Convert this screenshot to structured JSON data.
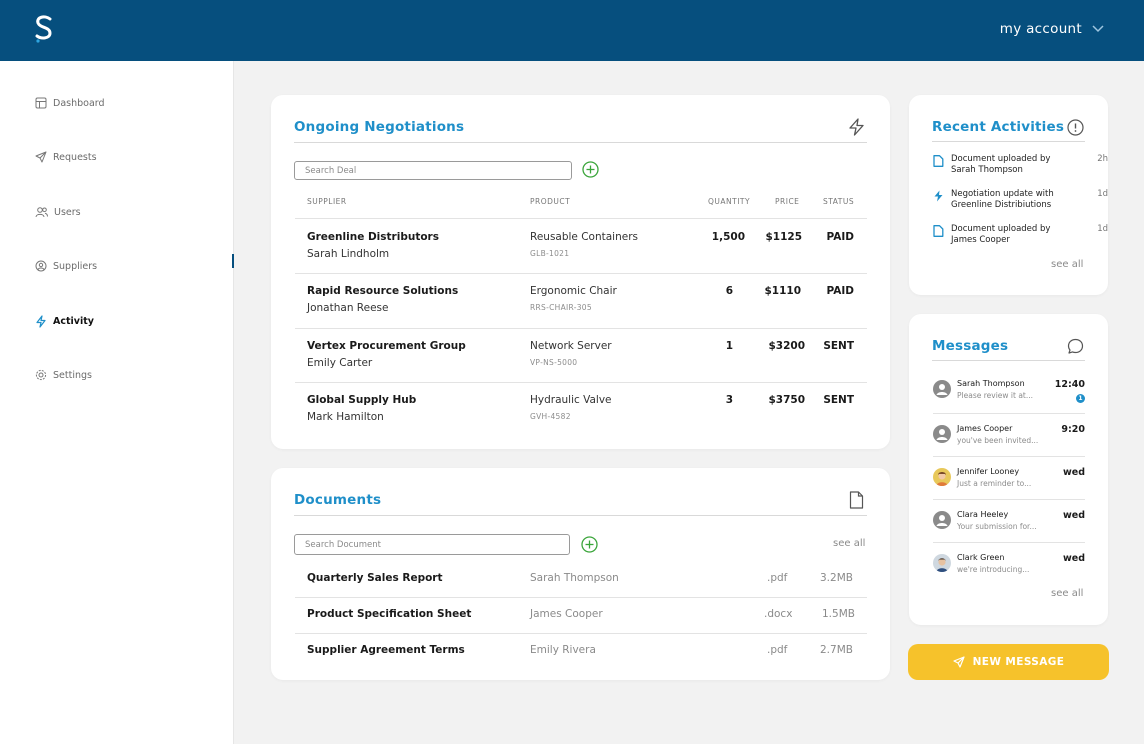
{
  "header": {
    "account_label": "my account",
    "color": "#064f7e"
  },
  "sidebar": {
    "items": [
      {
        "label": "Dashboard",
        "icon": "dashboard-icon"
      },
      {
        "label": "Requests",
        "icon": "send-icon"
      },
      {
        "label": "Users",
        "icon": "users-icon"
      },
      {
        "label": "Suppliers",
        "icon": "suppliers-icon"
      },
      {
        "label": "Activity",
        "icon": "lightning-icon",
        "active": true
      },
      {
        "label": "Settings",
        "icon": "gear-icon"
      }
    ]
  },
  "negotiations": {
    "title": "Ongoing Negotiations",
    "search_placeholder": "Search Deal",
    "columns": {
      "supplier": "SUPPLIER",
      "product": "PRODUCT",
      "quantity": "QUANTITY",
      "price": "PRICE",
      "status": "STATUS"
    },
    "rows": [
      {
        "supplier": "Greenline Distributors",
        "contact": "Sarah Lindholm",
        "product": "Reusable Containers",
        "sku": "GLB-1021",
        "quantity": "1,500",
        "price": "$1125",
        "status": "PAID"
      },
      {
        "supplier": "Rapid Resource Solutions",
        "contact": "Jonathan Reese",
        "product": "Ergonomic Chair",
        "sku": "RRS-CHAIR-305",
        "quantity": "6",
        "price": "$1110",
        "status": "PAID"
      },
      {
        "supplier": "Vertex Procurement Group",
        "contact": "Emily Carter",
        "product": "Network Server",
        "sku": "VP-NS-5000",
        "quantity": "1",
        "price": "$3200",
        "status": "SENT"
      },
      {
        "supplier": "Global Supply Hub",
        "contact": "Mark Hamilton",
        "product": "Hydraulic Valve",
        "sku": "GVH-4582",
        "quantity": "3",
        "price": "$3750",
        "status": "SENT"
      }
    ]
  },
  "documents": {
    "title": "Documents",
    "search_placeholder": "Search Document",
    "see_all": "see all",
    "rows": [
      {
        "name": "Quarterly Sales Report",
        "owner": "Sarah Thompson",
        "ext": ".pdf",
        "size": "3.2MB"
      },
      {
        "name": "Product Specification Sheet",
        "owner": "James Cooper",
        "ext": ".docx",
        "size": "1.5MB"
      },
      {
        "name": "Supplier Agreement Terms",
        "owner": "Emily Rivera",
        "ext": ".pdf",
        "size": "2.7MB"
      }
    ]
  },
  "activities": {
    "title": "Recent Activities",
    "see_all": "see all",
    "items": [
      {
        "text": "Document uploaded by Sarah Thompson",
        "time": "2h",
        "icon": "document-icon"
      },
      {
        "text": "Negotiation update with Greenline Distribiutions",
        "time": "1d",
        "icon": "lightning-icon"
      },
      {
        "text": "Document uploaded by James Cooper",
        "time": "1d",
        "icon": "document-icon"
      }
    ]
  },
  "messages": {
    "title": "Messages",
    "see_all": "see all",
    "new_message_label": "NEW MESSAGE",
    "items": [
      {
        "name": "Sarah Thompson",
        "preview": "Please review it at...",
        "time": "12:40",
        "unread": "1"
      },
      {
        "name": "James Cooper",
        "preview": "you've been invited...",
        "time": "9:20"
      },
      {
        "name": "Jennifer Looney",
        "preview": "Just a reminder to...",
        "time": "wed"
      },
      {
        "name": "Clara Heeley",
        "preview": "Your submission for...",
        "time": "wed"
      },
      {
        "name": "Clark Green",
        "preview": "we're introducing...",
        "time": "wed"
      }
    ]
  },
  "colors": {
    "accent": "#1f8fc9",
    "topbar": "#064f7e",
    "cta": "#f6c22b",
    "add": "#3aa53a"
  }
}
